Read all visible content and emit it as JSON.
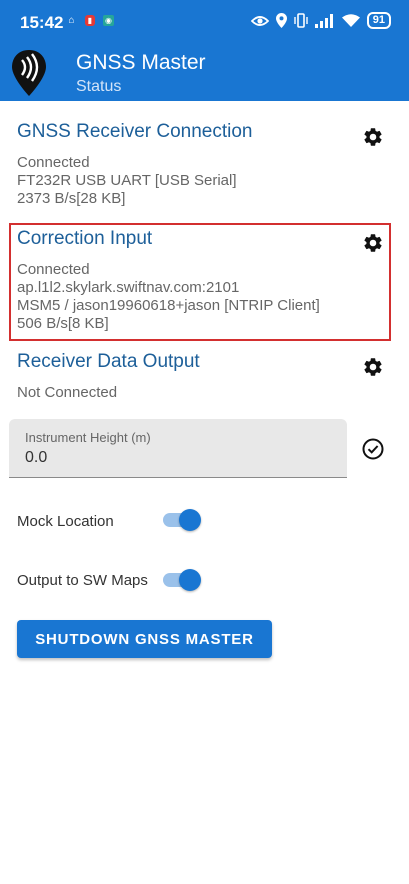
{
  "status_bar": {
    "time": "15:42",
    "battery": "91"
  },
  "app_bar": {
    "title": "GNSS Master",
    "subtitle": "Status"
  },
  "receiver_connection": {
    "title": "GNSS Receiver Connection",
    "status": "Connected",
    "device": "FT232R USB UART [USB Serial]",
    "rate": "2373 B/s[28 KB]"
  },
  "correction_input": {
    "title": "Correction Input",
    "status": "Connected",
    "host": "ap.l1l2.skylark.swiftnav.com:2101",
    "mount": "MSM5 / jason19960618+jason [NTRIP Client]",
    "rate": "506 B/s[8 KB]"
  },
  "data_output": {
    "title": "Receiver Data Output",
    "status": "Not Connected"
  },
  "instrument_height": {
    "label": "Instrument Height (m)",
    "value": "0.0"
  },
  "toggles": {
    "mock_location": {
      "label": "Mock Location",
      "on": true
    },
    "sw_maps": {
      "label": "Output to SW Maps",
      "on": true
    }
  },
  "shutdown_button": "SHUTDOWN GNSS MASTER",
  "colors": {
    "primary": "#1976d2",
    "title_blue": "#1d5f99",
    "highlight_red": "#d32f2f"
  }
}
